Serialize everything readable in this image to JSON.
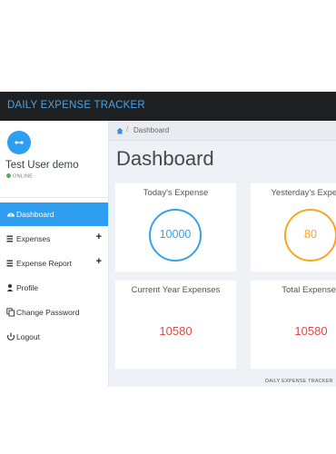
{
  "header": {
    "brand": "DAILY EXPENSE TRACKER"
  },
  "sidebar": {
    "user_name": "Test User demo",
    "status": "ONLINE",
    "items": [
      {
        "label": "Dashboard",
        "icon": "dashboard-icon",
        "active": true
      },
      {
        "label": "Expenses",
        "icon": "list-icon",
        "expandable": true
      },
      {
        "label": "Expense Report",
        "icon": "list-icon",
        "expandable": true
      },
      {
        "label": "Profile",
        "icon": "user-icon"
      },
      {
        "label": "Change Password",
        "icon": "copy-icon"
      },
      {
        "label": "Logout",
        "icon": "power-icon"
      }
    ],
    "expand_symbol": "+"
  },
  "breadcrumb": {
    "separator": "/",
    "current": "Dashboard"
  },
  "page_title": "Dashboard",
  "cards": {
    "today": {
      "title": "Today's Expense",
      "value": "10000",
      "color": "#3aa0e8"
    },
    "yesterday": {
      "title": "Yesterday's Expense",
      "value": "80",
      "color": "#f5a623"
    },
    "current_year": {
      "title": "Current Year Expenses",
      "value": "10580"
    },
    "total": {
      "title": "Total Expenses",
      "value": "10580"
    }
  },
  "footer": {
    "text": "DAILY EXPENSE TRACKER"
  },
  "colors": {
    "accent": "#2e9ef0",
    "header_bg": "#1f2021",
    "value_red": "#e34a4a",
    "online": "#4cb050"
  }
}
